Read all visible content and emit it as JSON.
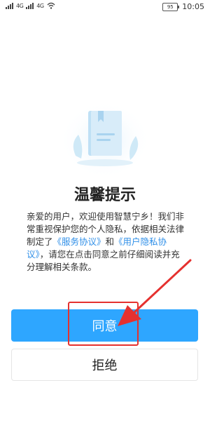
{
  "status_bar": {
    "network_1": "4G",
    "network_2": "4G",
    "battery": "95",
    "time": "10:05",
    "icons": [
      "signal-icon",
      "wifi-icon",
      "battery-icon"
    ]
  },
  "dialog": {
    "title": "温馨提示",
    "message_prefix": "亲爱的用户，欢迎使用智慧宁乡！我们非常重视保护您的个人隐私，依据相关法律制定了",
    "link_service": "《服务协议》",
    "message_and": "和",
    "link_privacy": "《用户隐私协议》",
    "message_suffix": "，请您在点击同意之前仔细阅读并充分理解相关条款。",
    "illustration_icon": "book-icon"
  },
  "buttons": {
    "agree": "同意",
    "reject": "拒绝"
  },
  "colors": {
    "accent": "#2ea6ff",
    "link": "#2f8fe8",
    "annotation": "#e5312f"
  }
}
